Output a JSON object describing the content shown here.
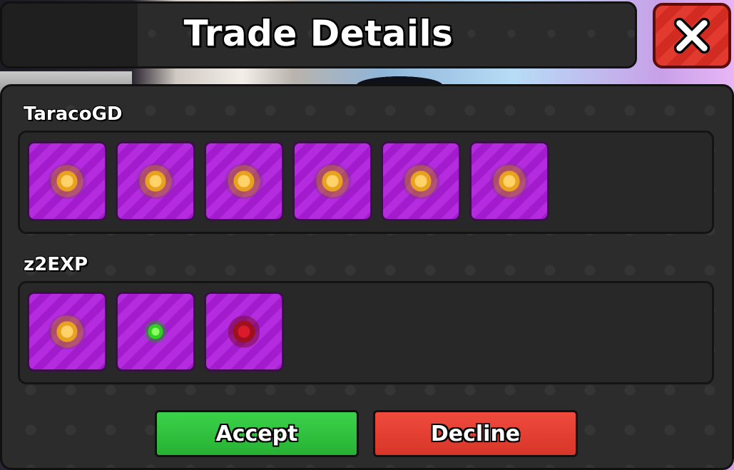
{
  "header": {
    "title": "Trade Details",
    "close_icon": "close-icon"
  },
  "trade": {
    "players": [
      {
        "name": "TaracoGD",
        "items": [
          {
            "icon": "gold-orb-icon"
          },
          {
            "icon": "gold-orb-icon"
          },
          {
            "icon": "gold-orb-icon"
          },
          {
            "icon": "gold-orb-icon"
          },
          {
            "icon": "gold-orb-icon"
          },
          {
            "icon": "gold-orb-icon"
          }
        ]
      },
      {
        "name": "z2EXP",
        "items": [
          {
            "icon": "gold-orb-icon"
          },
          {
            "icon": "green-orb-icon"
          },
          {
            "icon": "red-orb-icon"
          }
        ]
      }
    ]
  },
  "actions": {
    "accept_label": "Accept",
    "decline_label": "Decline"
  },
  "colors": {
    "slot_purple": "#b52be0",
    "accept_green": "#2fbf3b",
    "decline_red": "#e23f33",
    "close_red": "#e23a2f"
  }
}
